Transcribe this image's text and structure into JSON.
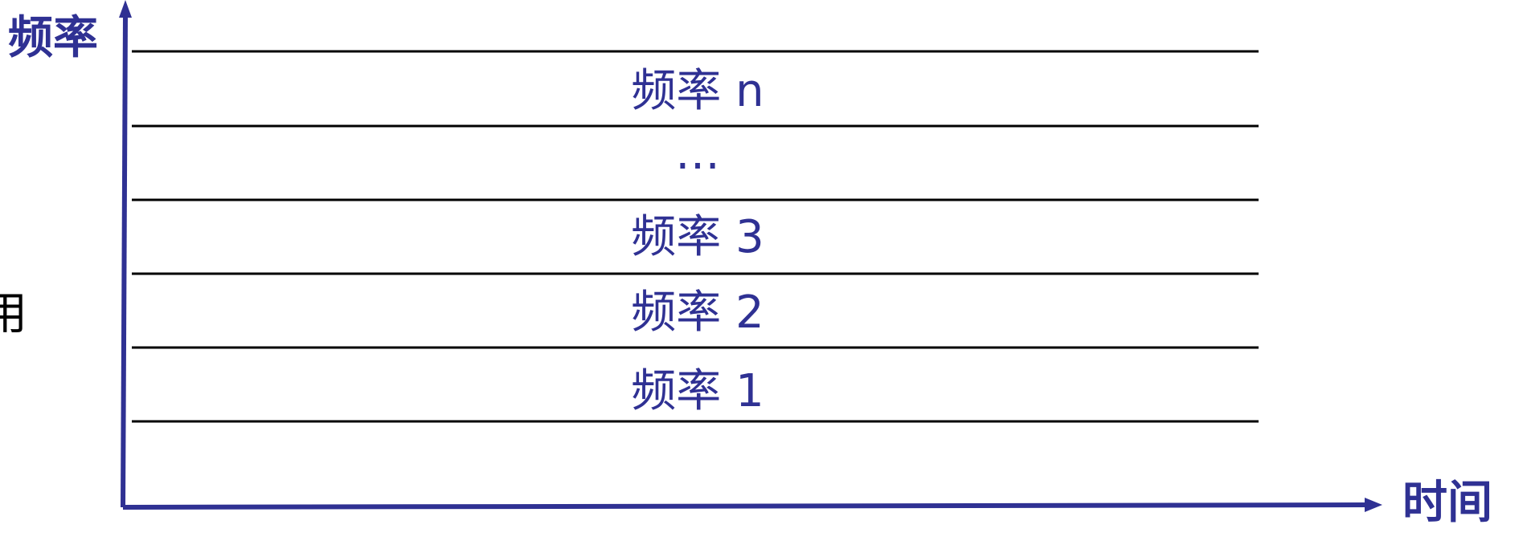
{
  "diagram": {
    "y_axis_label": "频率",
    "x_axis_label": "时间",
    "side_text": "用",
    "bands": [
      {
        "label": "频率 n"
      },
      {
        "label": "…"
      },
      {
        "label": "频率 3"
      },
      {
        "label": "频率 2"
      },
      {
        "label": "频率 1"
      }
    ]
  },
  "colors": {
    "axis": "#2f3193",
    "label": "#2f3193",
    "band_line": "#000000",
    "side_text": "#000000"
  }
}
